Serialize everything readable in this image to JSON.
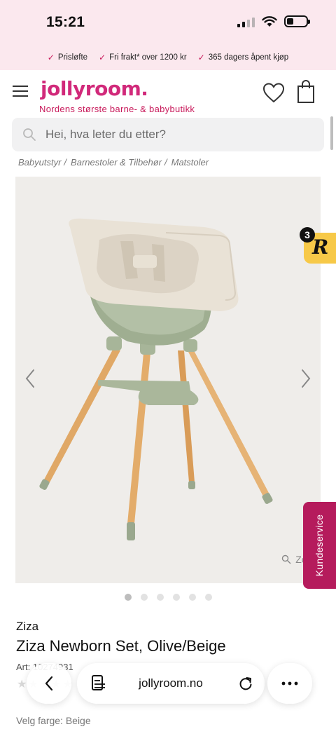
{
  "status": {
    "time": "15:21",
    "battery_level": 0.25
  },
  "usp": [
    "Prisløfte",
    "Fri frakt* over 1200 kr",
    "365 dagers åpent kjøp"
  ],
  "header": {
    "logo": "jollyroom.",
    "tagline": "Nordens største barne- & babybutikk"
  },
  "search": {
    "placeholder": "Hei, hva leter du etter?"
  },
  "breadcrumb": [
    "Babyutstyr",
    "Barnestoler & Tilbehør",
    "Matstoler"
  ],
  "gallery": {
    "zoom_label": "Zoom",
    "image_count": 6,
    "active_index": 0
  },
  "badge": {
    "count": "3",
    "letter": "R"
  },
  "service_tab": {
    "label": "Kundeservice"
  },
  "product": {
    "brand": "Ziza",
    "title": "Ziza Newborn Set, Olive/Beige",
    "article": "Art: 10274931",
    "color_label": "Velg farge: Beige"
  },
  "browser": {
    "url": "jollyroom.no"
  },
  "colors": {
    "accent": "#d1297a",
    "service": "#b51b5c",
    "top_bar": "#fbe8ee",
    "badge": "#f7c948"
  }
}
